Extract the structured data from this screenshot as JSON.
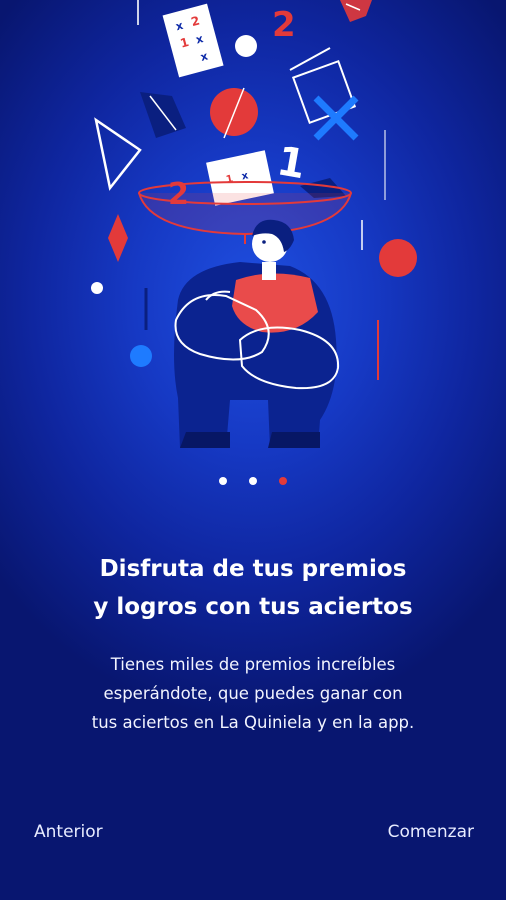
{
  "pager": {
    "total": 3,
    "active_index": 2
  },
  "content": {
    "title_line1": "Disfruta de tus premios",
    "title_line2": "y logros con tus aciertos",
    "body_line1": "Tienes miles de premios increíbles",
    "body_line2": "esperándote, que puedes ganar con",
    "body_line3": "tus aciertos en La Quiniela y en la app."
  },
  "footer": {
    "prev_label": "Anterior",
    "start_label": "Comenzar"
  },
  "illustration": {
    "ticket_marks": [
      "x",
      "2",
      "1",
      "x",
      "x"
    ],
    "floating_numbers": [
      "2",
      "1",
      "2"
    ],
    "colors": {
      "accent_red": "#e33a3a",
      "line_white": "#ffffff",
      "dark_blue": "#0d2aa8"
    }
  }
}
